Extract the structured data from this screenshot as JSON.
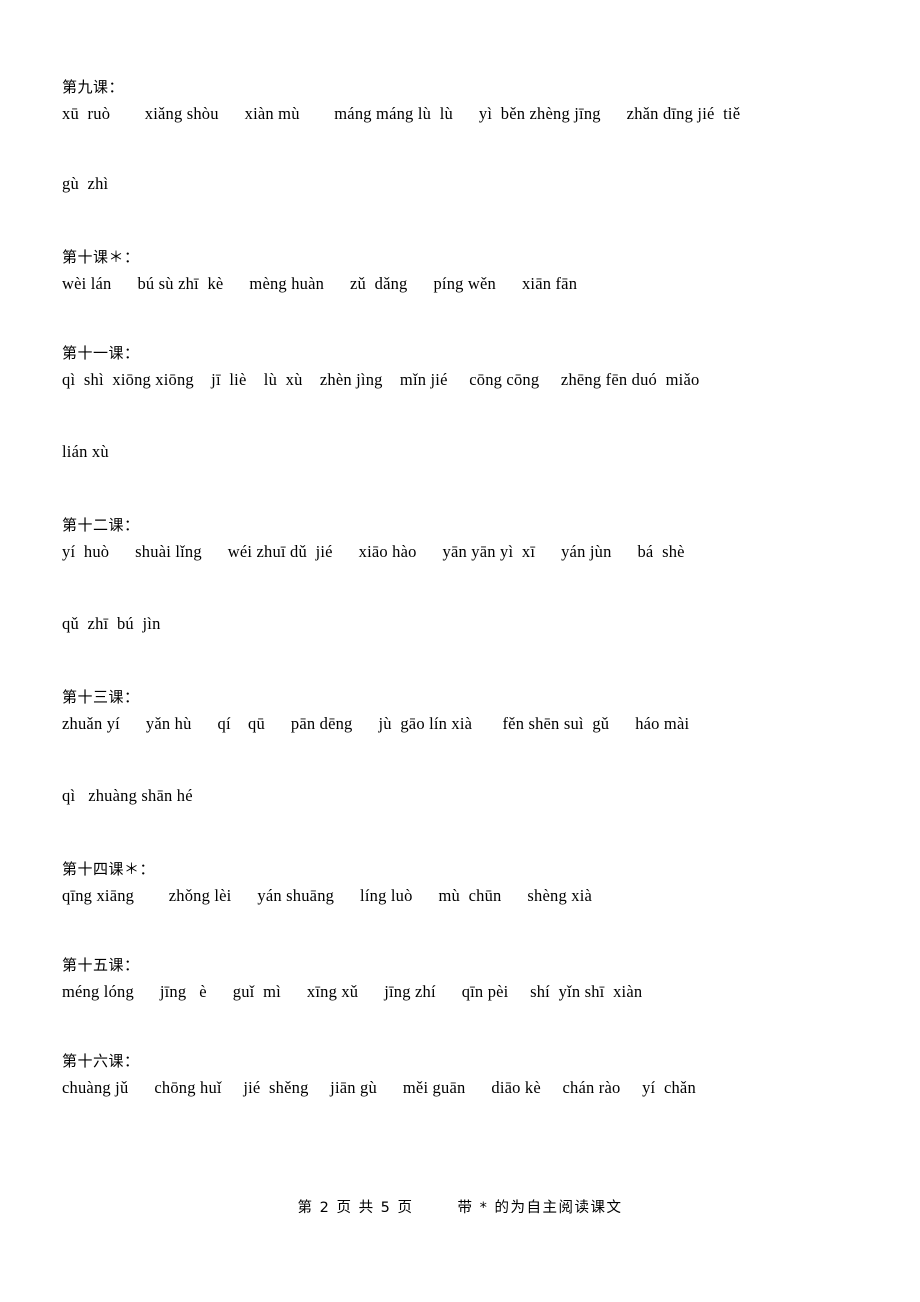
{
  "document": {
    "kind": "pinyin-vocabulary-worksheet",
    "footer": {
      "page_label": "第 2 页 共 5 页",
      "note": "带 * 的为自主阅读课文"
    }
  },
  "lessons": [
    {
      "id": "lesson-09",
      "title": "第九课：",
      "starred": false,
      "lines": [
        "xū  ruò        xiǎng shòu      xiàn mù        máng máng lù  lù      yì  běn zhèng jīng      zhǎn dīng jié  tiě",
        "gù  zhì"
      ],
      "words": [
        "xū ruò",
        "xiǎng shòu",
        "xiàn mù",
        "máng máng lù lù",
        "yì běn zhèng jīng",
        "zhǎn dīng jié tiě",
        "gù zhì"
      ]
    },
    {
      "id": "lesson-10",
      "title": "第十课＊：",
      "starred": true,
      "lines": [
        "wèi lán      bú sù zhī  kè      mèng huàn      zǔ  dǎng      píng wěn      xiān fān"
      ],
      "words": [
        "wèi lán",
        "bú sù zhī kè",
        "mèng huàn",
        "zǔ dǎng",
        "píng wěn",
        "xiān fān"
      ]
    },
    {
      "id": "lesson-11",
      "title": "第十一课：",
      "starred": false,
      "lines": [
        "qì  shì  xiōng xiōng    jī  liè    lù  xù    zhèn jìng    mǐn jié     cōng cōng     zhēng fēn duó  miǎo",
        "lián xù"
      ],
      "words": [
        "qì shì xiōng xiōng",
        "jī liè",
        "lù xù",
        "zhèn jìng",
        "mǐn jié",
        "cōng cōng",
        "zhēng fēn duó miǎo",
        "lián xù"
      ]
    },
    {
      "id": "lesson-12",
      "title": "第十二课：",
      "starred": false,
      "lines": [
        "yí  huò      shuài lǐng      wéi zhuī dǔ  jié      xiāo hào      yān yān yì  xī      yán jùn      bá  shè",
        "qǔ  zhī  bú  jìn"
      ],
      "words": [
        "yí huò",
        "shuài lǐng",
        "wéi zhuī dǔ jié",
        "xiāo hào",
        "yān yān yì xī",
        "yán jùn",
        "bá shè",
        "qǔ zhī bú jìn"
      ]
    },
    {
      "id": "lesson-13",
      "title": "第十三课：",
      "starred": false,
      "lines": [
        "zhuǎn yí      yǎn hù      qí    qū      pān dēng      jù  gāo lín xià       fěn shēn suì  gǔ      háo mài",
        "qì   zhuàng shān hé"
      ],
      "words": [
        "zhuǎn yí",
        "yǎn hù",
        "qí qū",
        "pān dēng",
        "jù gāo lín xià",
        "fěn shēn suì gǔ",
        "háo mài",
        "qì zhuàng shān hé"
      ]
    },
    {
      "id": "lesson-14",
      "title": "第十四课＊：",
      "starred": true,
      "lines": [
        "qīng xiāng        zhǒng lèi      yán shuāng      líng luò      mù  chūn      shèng xià"
      ],
      "words": [
        "qīng xiāng",
        "zhǒng lèi",
        "yán shuāng",
        "líng luò",
        "mù chūn",
        "shèng xià"
      ]
    },
    {
      "id": "lesson-15",
      "title": "第十五课：",
      "starred": false,
      "lines": [
        "méng lóng      jīng   è      guǐ  mì      xīng xǔ      jīng zhí      qīn pèi     shí  yǐn shī  xiàn"
      ],
      "words": [
        "méng lóng",
        "jīng è",
        "guǐ mì",
        "xīng xǔ",
        "jīng zhí",
        "qīn pèi",
        "shí yǐn shī xiàn"
      ]
    },
    {
      "id": "lesson-16",
      "title": "第十六课：",
      "starred": false,
      "lines": [
        "chuàng jǔ      chōng huǐ     jié  shěng     jiān gù      měi guān      diāo kè     chán rào     yí  chǎn"
      ],
      "words": [
        "chuàng jǔ",
        "chōng huǐ",
        "jié shěng",
        "jiān gù",
        "měi guān",
        "diāo kè",
        "chán rào",
        "yí chǎn"
      ]
    }
  ]
}
